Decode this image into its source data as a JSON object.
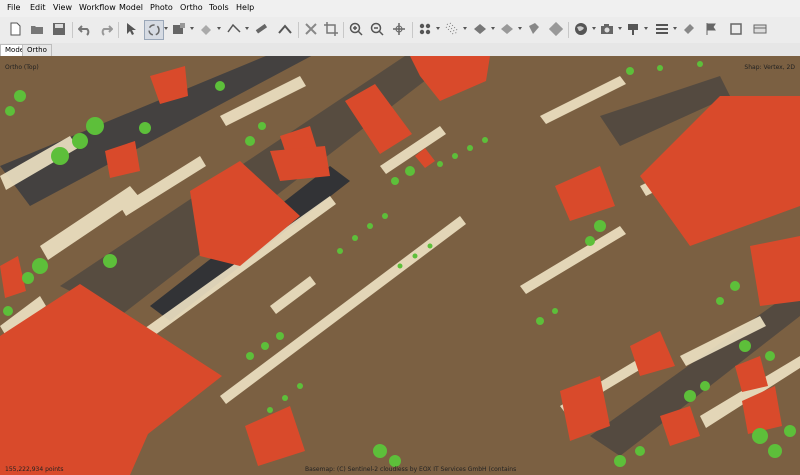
{
  "menu": [
    "File",
    "Edit",
    "View",
    "Workflow",
    "Model",
    "Photo",
    "Ortho",
    "Tools",
    "Help"
  ],
  "tabs": [
    "Model",
    "Ortho"
  ],
  "viewport": {
    "top_left": "Ortho (Top)",
    "top_right": "Shap: Vertex, 2D",
    "bottom_left": "155,222,934 points",
    "bottom_center": "Basemap: (C) Sentinel-2 cloudless by EOX IT Services GmbH (contains"
  },
  "colors": {
    "ground": "#7b6042",
    "roof": "#d94a2b",
    "trees": "#5dbf3a",
    "shadow": "#3a3a3c",
    "wall": "#efe3c4"
  },
  "toolbar_icons": [
    "new-icon",
    "open-icon",
    "save-icon",
    "undo-icon",
    "redo-icon",
    "pointer-icon",
    "rotate-icon",
    "rectangle-select-icon",
    "shape-icon",
    "polyline-icon",
    "ruler-icon",
    "angle-icon",
    "delete-icon",
    "crop-icon",
    "zoom-in-icon",
    "zoom-out-icon",
    "move-icon",
    "points-icon",
    "dense-cloud-icon",
    "mesh-icon",
    "texture-icon",
    "tiled-model-icon",
    "model-view-icon",
    "camera-icon",
    "pin-icon",
    "markers-icon",
    "shapes-icon",
    "flag-icon",
    "region-icon"
  ]
}
